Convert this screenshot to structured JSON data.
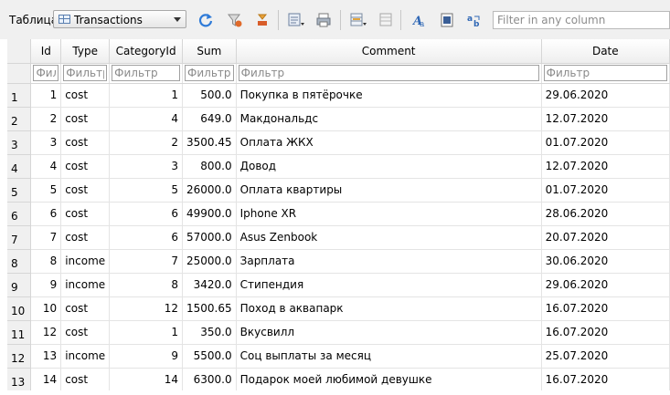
{
  "toolbar": {
    "table_label": "Таблица:",
    "table_selected": "Transactions",
    "filter_placeholder": "Filter in any column"
  },
  "icons": [
    "refresh-icon",
    "clear-filters-icon",
    "delete-filter-icon",
    "export-icon",
    "print-icon",
    "insert-record-icon",
    "delete-record-icon",
    "font-icon",
    "binary-icon",
    "encoding-icon"
  ],
  "columns": [
    "Id",
    "Type",
    "CategoryId",
    "Sum",
    "Comment",
    "Date"
  ],
  "filter_placeholders": [
    "Фильтр",
    "Фильтр",
    "Фильтр",
    "Фильтр",
    "Фильтр",
    "Фильтр"
  ],
  "rows": [
    {
      "n": "1",
      "id": "1",
      "type": "cost",
      "cat": "1",
      "sum": "500.0",
      "comment": "Покупка в пятёрочке",
      "date": "29.06.2020"
    },
    {
      "n": "2",
      "id": "2",
      "type": "cost",
      "cat": "4",
      "sum": "649.0",
      "comment": "Макдональдс",
      "date": "12.07.2020"
    },
    {
      "n": "3",
      "id": "3",
      "type": "cost",
      "cat": "2",
      "sum": "3500.45",
      "comment": "Оплата ЖКХ",
      "date": "01.07.2020"
    },
    {
      "n": "4",
      "id": "4",
      "type": "cost",
      "cat": "3",
      "sum": "800.0",
      "comment": "Довод",
      "date": "12.07.2020"
    },
    {
      "n": "5",
      "id": "5",
      "type": "cost",
      "cat": "5",
      "sum": "26000.0",
      "comment": "Оплата квартиры",
      "date": "01.07.2020"
    },
    {
      "n": "6",
      "id": "6",
      "type": "cost",
      "cat": "6",
      "sum": "49900.0",
      "comment": "Iphone XR",
      "date": "28.06.2020"
    },
    {
      "n": "7",
      "id": "7",
      "type": "cost",
      "cat": "6",
      "sum": "57000.0",
      "comment": "Asus Zenbook",
      "date": "20.07.2020"
    },
    {
      "n": "8",
      "id": "8",
      "type": "income",
      "cat": "7",
      "sum": "25000.0",
      "comment": "Зарплата",
      "date": "30.06.2020"
    },
    {
      "n": "9",
      "id": "9",
      "type": "income",
      "cat": "8",
      "sum": "3420.0",
      "comment": "Стипендия",
      "date": "29.06.2020"
    },
    {
      "n": "10",
      "id": "10",
      "type": "cost",
      "cat": "12",
      "sum": "1500.65",
      "comment": "Поход в аквапарк",
      "date": "16.07.2020"
    },
    {
      "n": "11",
      "id": "12",
      "type": "cost",
      "cat": "1",
      "sum": "350.0",
      "comment": "Вкусвилл",
      "date": "16.07.2020"
    },
    {
      "n": "12",
      "id": "13",
      "type": "income",
      "cat": "9",
      "sum": "5500.0",
      "comment": "Соц выплаты за месяц",
      "date": "25.07.2020"
    },
    {
      "n": "13",
      "id": "14",
      "type": "cost",
      "cat": "14",
      "sum": "6300.0",
      "comment": "Подарок моей любимой девушке",
      "date": "16.07.2020"
    }
  ]
}
